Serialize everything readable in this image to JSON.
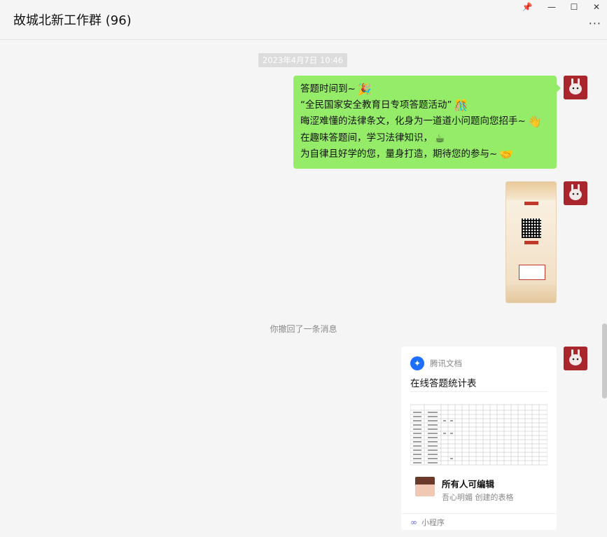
{
  "window": {
    "title": "故城北新工作群 (96)",
    "pin_icon": "pin-icon",
    "minimize_icon": "minimize-icon",
    "maximize_icon": "maximize-icon",
    "more_icon": "more-icon"
  },
  "chat": {
    "timestamp": "2023年4月7日 10:46",
    "text_message": {
      "lines": [
        {
          "text": "答题时间到~",
          "emoji": "🎉"
        },
        {
          "text": "“全民国家安全教育日专项答题活动”",
          "emoji": "🎊"
        },
        {
          "text": "晦涩难懂的法律条文，化身为一道道小问题向您招手~",
          "emoji": "👋"
        },
        {
          "text": "在趣味答题间，学习法律知识，",
          "emoji": "☕"
        },
        {
          "text": "为自律且好学的您，量身打造，期待您的参与~",
          "emoji": "🤝"
        }
      ]
    },
    "recall_notice": "你撤回了一条消息",
    "card": {
      "app_name": "腾讯文档",
      "title": "在线答题统计表",
      "editor_title": "所有人可编辑",
      "editor_sub": "吾心明媚 创建的表格",
      "footer_label": "小程序"
    }
  },
  "colors": {
    "bubble": "#95ec69",
    "avatar": "#a8262c",
    "app_icon": "#1e6fff"
  }
}
